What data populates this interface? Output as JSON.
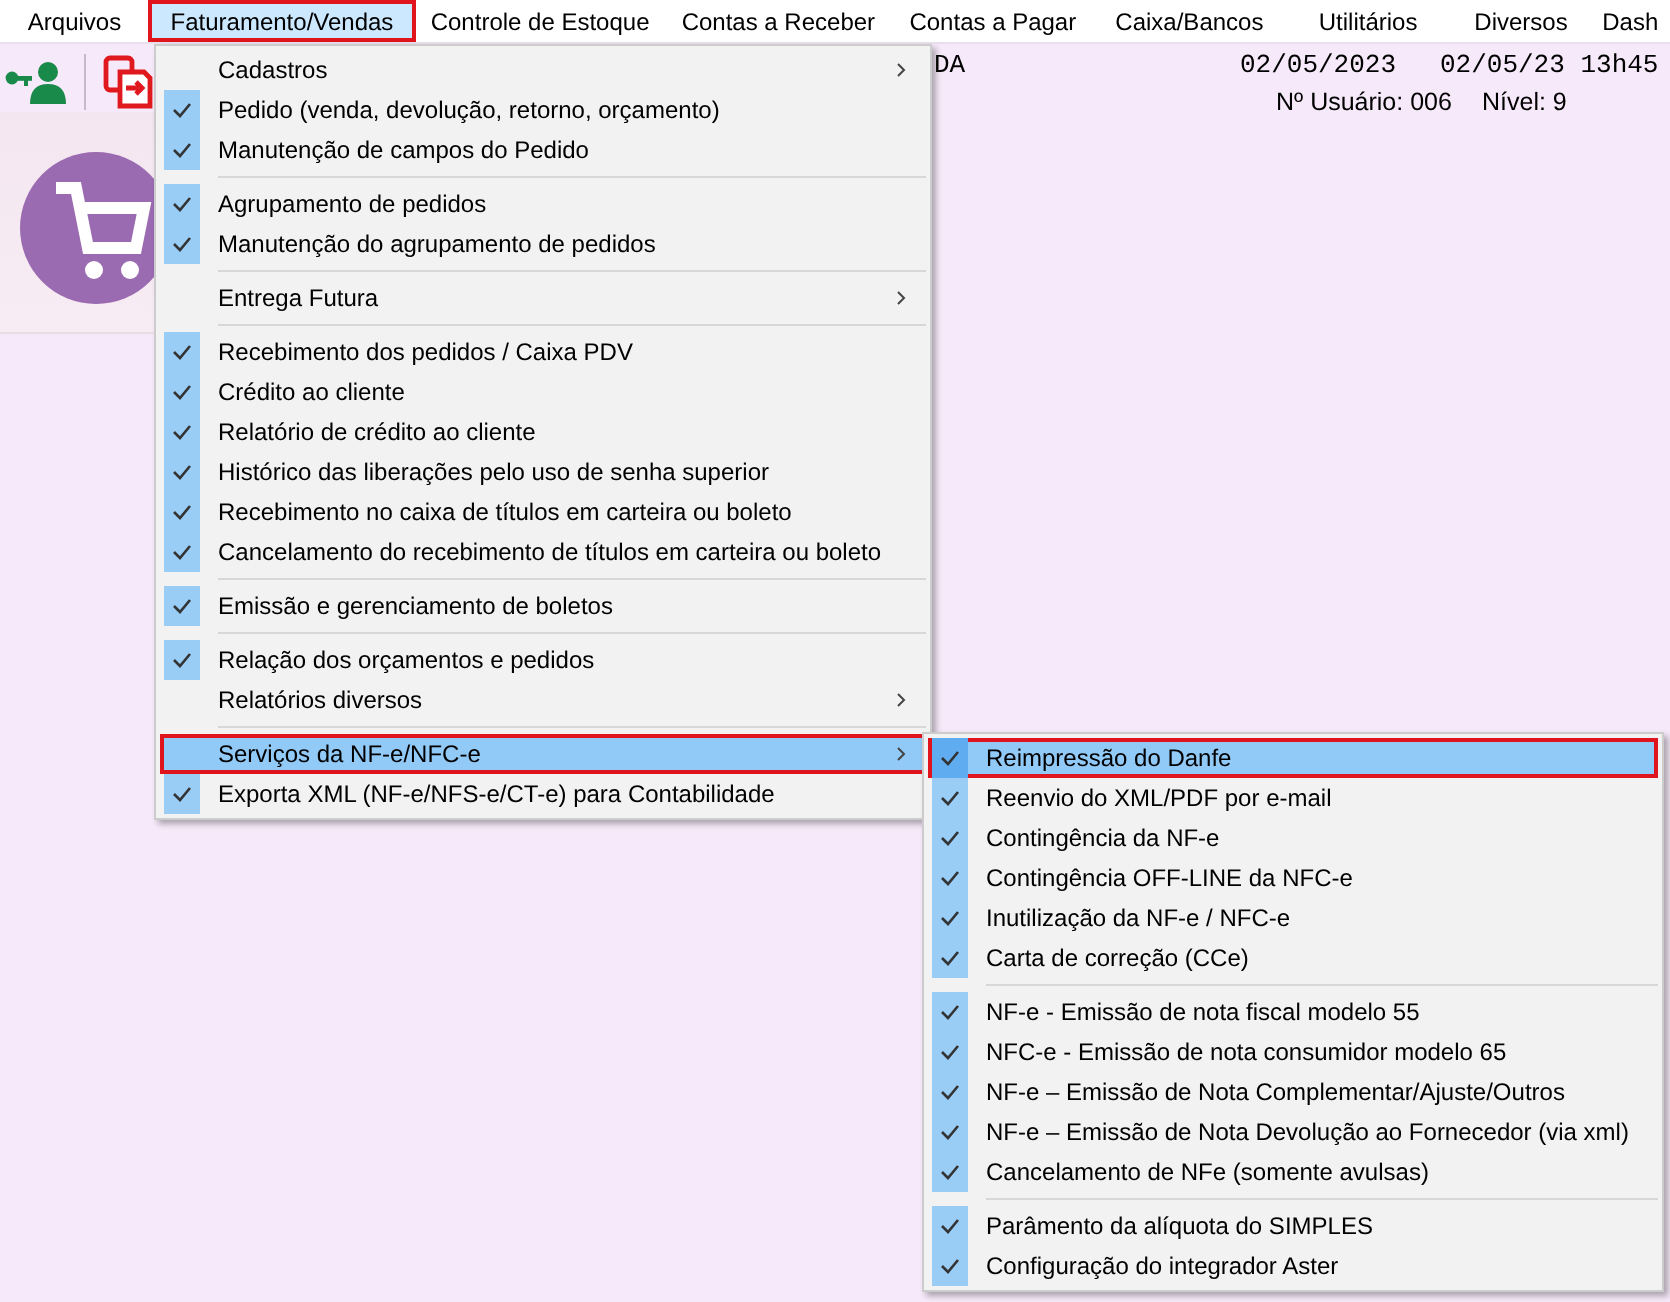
{
  "menu_bar": [
    {
      "label": "Arquivos",
      "selected": false,
      "outlined": false
    },
    {
      "label": "Faturamento/Vendas",
      "selected": true,
      "outlined": true
    },
    {
      "label": "Controle de Estoque",
      "selected": false,
      "outlined": false
    },
    {
      "label": "Contas a Receber",
      "selected": false,
      "outlined": false
    },
    {
      "label": "Contas a Pagar",
      "selected": false,
      "outlined": false
    },
    {
      "label": "Caixa/Bancos",
      "selected": false,
      "outlined": false
    },
    {
      "label": "Utilitários",
      "selected": false,
      "outlined": false
    },
    {
      "label": "Diversos",
      "selected": false,
      "outlined": false
    },
    {
      "label": "Dash",
      "selected": false,
      "outlined": false
    }
  ],
  "header": {
    "company": "DA",
    "date": "02/05/2023",
    "datetime": "02/05/23 13h45",
    "user": "Nº Usuário: 006",
    "level": "Nível: 9"
  },
  "menu": {
    "items": [
      {
        "kind": "item",
        "label": "Cadastros",
        "checked": false,
        "has_submenu": true,
        "selected": false,
        "outlined": false
      },
      {
        "kind": "item",
        "label": "Pedido (venda, devolução, retorno, orçamento)",
        "checked": true,
        "has_submenu": false,
        "selected": false,
        "outlined": false
      },
      {
        "kind": "item",
        "label": "Manutenção de campos do Pedido",
        "checked": true,
        "has_submenu": false,
        "selected": false,
        "outlined": false
      },
      {
        "kind": "separator"
      },
      {
        "kind": "item",
        "label": "Agrupamento de pedidos",
        "checked": true,
        "has_submenu": false,
        "selected": false,
        "outlined": false
      },
      {
        "kind": "item",
        "label": "Manutenção do agrupamento de pedidos",
        "checked": true,
        "has_submenu": false,
        "selected": false,
        "outlined": false
      },
      {
        "kind": "separator"
      },
      {
        "kind": "item",
        "label": "Entrega Futura",
        "checked": false,
        "has_submenu": true,
        "selected": false,
        "outlined": false
      },
      {
        "kind": "separator"
      },
      {
        "kind": "item",
        "label": "Recebimento dos pedidos / Caixa PDV",
        "checked": true,
        "has_submenu": false,
        "selected": false,
        "outlined": false
      },
      {
        "kind": "item",
        "label": "Crédito ao cliente",
        "checked": true,
        "has_submenu": false,
        "selected": false,
        "outlined": false
      },
      {
        "kind": "item",
        "label": "Relatório de crédito ao cliente",
        "checked": true,
        "has_submenu": false,
        "selected": false,
        "outlined": false
      },
      {
        "kind": "item",
        "label": "Histórico das liberações pelo uso de senha superior",
        "checked": true,
        "has_submenu": false,
        "selected": false,
        "outlined": false
      },
      {
        "kind": "item",
        "label": "Recebimento no caixa de títulos em carteira ou boleto",
        "checked": true,
        "has_submenu": false,
        "selected": false,
        "outlined": false
      },
      {
        "kind": "item",
        "label": "Cancelamento do recebimento de títulos em carteira ou boleto",
        "checked": true,
        "has_submenu": false,
        "selected": false,
        "outlined": false
      },
      {
        "kind": "separator"
      },
      {
        "kind": "item",
        "label": "Emissão e gerenciamento de boletos",
        "checked": true,
        "has_submenu": false,
        "selected": false,
        "outlined": false
      },
      {
        "kind": "separator"
      },
      {
        "kind": "item",
        "label": "Relação dos orçamentos e pedidos",
        "checked": true,
        "has_submenu": false,
        "selected": false,
        "outlined": false
      },
      {
        "kind": "item",
        "label": "Relatórios diversos",
        "checked": false,
        "has_submenu": true,
        "selected": false,
        "outlined": false
      },
      {
        "kind": "separator"
      },
      {
        "kind": "item",
        "label": "Serviços da NF-e/NFC-e",
        "checked": false,
        "has_submenu": true,
        "selected": true,
        "outlined": true
      },
      {
        "kind": "item",
        "label": "Exporta XML (NF-e/NFS-e/CT-e) para Contabilidade",
        "checked": true,
        "has_submenu": false,
        "selected": false,
        "outlined": false
      }
    ]
  },
  "submenu": {
    "items": [
      {
        "kind": "item",
        "label": "Reimpressão do Danfe",
        "checked": true,
        "has_submenu": false,
        "selected": true,
        "outlined": true
      },
      {
        "kind": "item",
        "label": "Reenvio do XML/PDF por e-mail",
        "checked": true,
        "has_submenu": false,
        "selected": false,
        "outlined": false
      },
      {
        "kind": "item",
        "label": "Contingência da NF-e",
        "checked": true,
        "has_submenu": false,
        "selected": false,
        "outlined": false
      },
      {
        "kind": "item",
        "label": "Contingência OFF-LINE da NFC-e",
        "checked": true,
        "has_submenu": false,
        "selected": false,
        "outlined": false
      },
      {
        "kind": "item",
        "label": "Inutilização da NF-e / NFC-e",
        "checked": true,
        "has_submenu": false,
        "selected": false,
        "outlined": false
      },
      {
        "kind": "item",
        "label": "Carta de correção (CCe)",
        "checked": true,
        "has_submenu": false,
        "selected": false,
        "outlined": false
      },
      {
        "kind": "separator"
      },
      {
        "kind": "item",
        "label": "NF-e - Emissão de nota fiscal modelo 55",
        "checked": true,
        "has_submenu": false,
        "selected": false,
        "outlined": false
      },
      {
        "kind": "item",
        "label": "NFC-e - Emissão de nota consumidor modelo 65",
        "checked": true,
        "has_submenu": false,
        "selected": false,
        "outlined": false
      },
      {
        "kind": "item",
        "label": "NF-e – Emissão de Nota Complementar/Ajuste/Outros",
        "checked": true,
        "has_submenu": false,
        "selected": false,
        "outlined": false
      },
      {
        "kind": "item",
        "label": "NF-e – Emissão de Nota Devolução ao Fornecedor (via xml)",
        "checked": true,
        "has_submenu": false,
        "selected": false,
        "outlined": false
      },
      {
        "kind": "item",
        "label": "Cancelamento de NFe (somente avulsas)",
        "checked": true,
        "has_submenu": false,
        "selected": false,
        "outlined": false
      },
      {
        "kind": "separator"
      },
      {
        "kind": "item",
        "label": "Parâmento da alíquota do SIMPLES",
        "checked": true,
        "has_submenu": false,
        "selected": false,
        "outlined": false
      },
      {
        "kind": "item",
        "label": "Configuração do integrador Aster",
        "checked": true,
        "has_submenu": false,
        "selected": false,
        "outlined": false
      }
    ]
  }
}
